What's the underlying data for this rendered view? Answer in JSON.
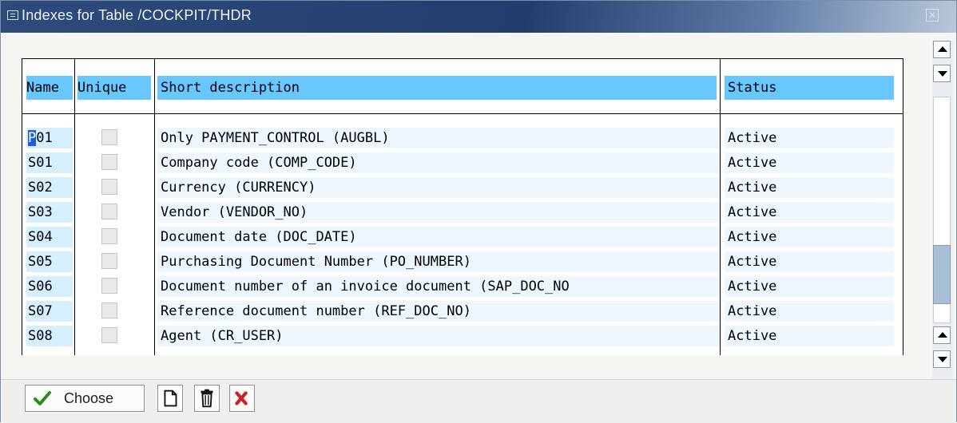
{
  "window": {
    "title": "Indexes for Table /COCKPIT/THDR",
    "close_glyph": "✕"
  },
  "table": {
    "columns": {
      "name": "Name",
      "unique": "Unique",
      "description": "Short description",
      "status": "Status"
    },
    "rows": [
      {
        "name": "P01",
        "unique": false,
        "description": "Only PAYMENT_CONTROL (AUGBL)",
        "status": "Active"
      },
      {
        "name": "S01",
        "unique": false,
        "description": "Company code (COMP_CODE)",
        "status": "Active"
      },
      {
        "name": "S02",
        "unique": false,
        "description": "Currency (CURRENCY)",
        "status": "Active"
      },
      {
        "name": "S03",
        "unique": false,
        "description": "Vendor (VENDOR_NO)",
        "status": "Active"
      },
      {
        "name": "S04",
        "unique": false,
        "description": "Document date (DOC_DATE)",
        "status": "Active"
      },
      {
        "name": "S05",
        "unique": false,
        "description": "Purchasing Document Number (PO_NUMBER)",
        "status": "Active"
      },
      {
        "name": "S06",
        "unique": false,
        "description": "Document number of an invoice document (SAP_DOC_NO",
        "status": "Active"
      },
      {
        "name": "S07",
        "unique": false,
        "description": "Reference document number (REF_DOC_NO)",
        "status": "Active"
      },
      {
        "name": "S08",
        "unique": false,
        "description": "Agent (CR_USER)",
        "status": "Active"
      }
    ]
  },
  "toolbar": {
    "choose_label": "Choose",
    "icons": [
      "checkmark-icon",
      "new-document-icon",
      "delete-trash-icon",
      "cancel-x-icon"
    ],
    "colors": {
      "check": "#2c8c1e",
      "cancel": "#d01f1f"
    }
  },
  "colors": {
    "header_bg": "#69c7ff",
    "row_bg": "#eef7ff",
    "name_bg": "#d6efff",
    "title_bg": "#233e6d"
  }
}
